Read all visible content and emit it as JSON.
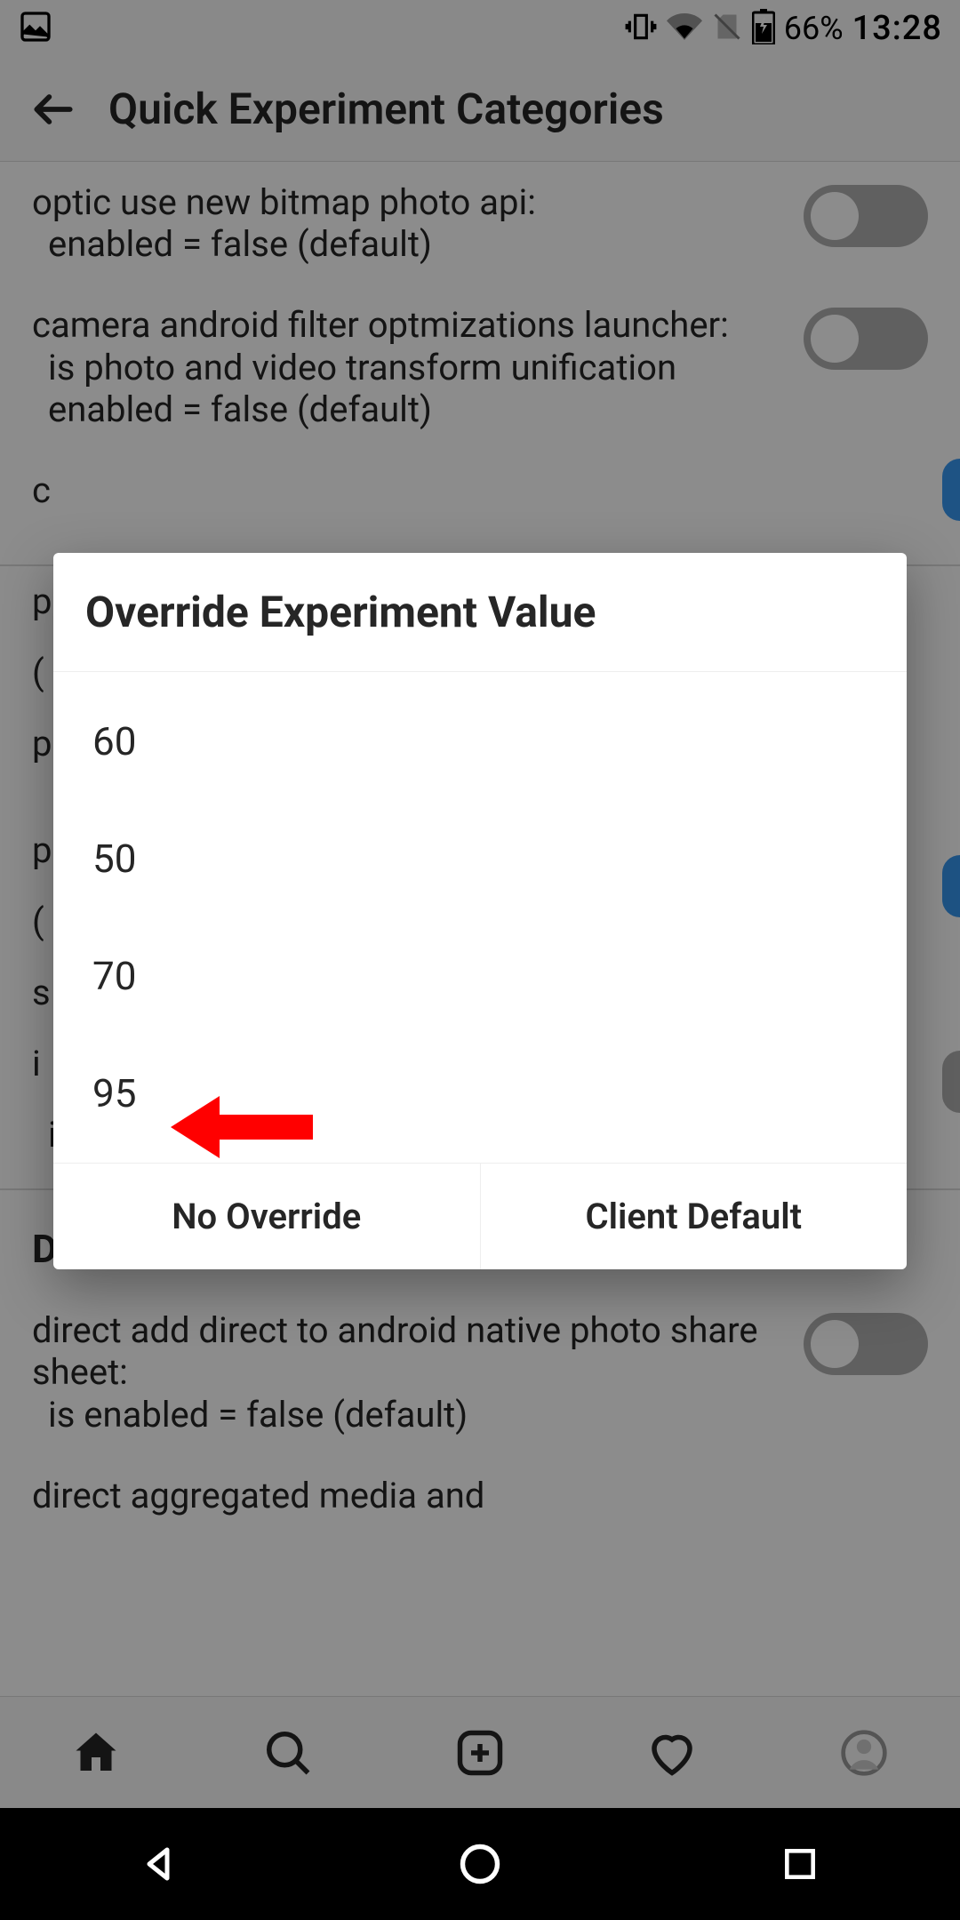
{
  "status": {
    "battery_pct": "66%",
    "clock": "13:28"
  },
  "appbar": {
    "title": "Quick Experiment Categories"
  },
  "experiments": {
    "item1_line1": "optic use new bitmap photo api:",
    "item1_line2": "enabled = false (default)",
    "item2_line1": "camera android filter optmizations launcher:",
    "item2_line2": "is photo and video transform unification enabled = false (default)",
    "section_direct": "Direct",
    "item3_line1": "direct add direct to android native photo share sheet:",
    "item3_line2": "is enabled = false (default)",
    "item4_line1": "direct aggregated media and",
    "fragment_c": "c",
    "fragment_p1": "p",
    "fragment_paren1": "(",
    "fragment_p2": "p",
    "fragment_p3": "p",
    "fragment_paren2": "(",
    "fragment_s": "s",
    "fragment_i": "i",
    "fragment_enabled": "is enabled = false (default)"
  },
  "dialog": {
    "title": "Override Experiment Value",
    "options": [
      "60",
      "50",
      "70",
      "95"
    ],
    "btn_no_override": "No Override",
    "btn_client_default": "Client Default"
  }
}
